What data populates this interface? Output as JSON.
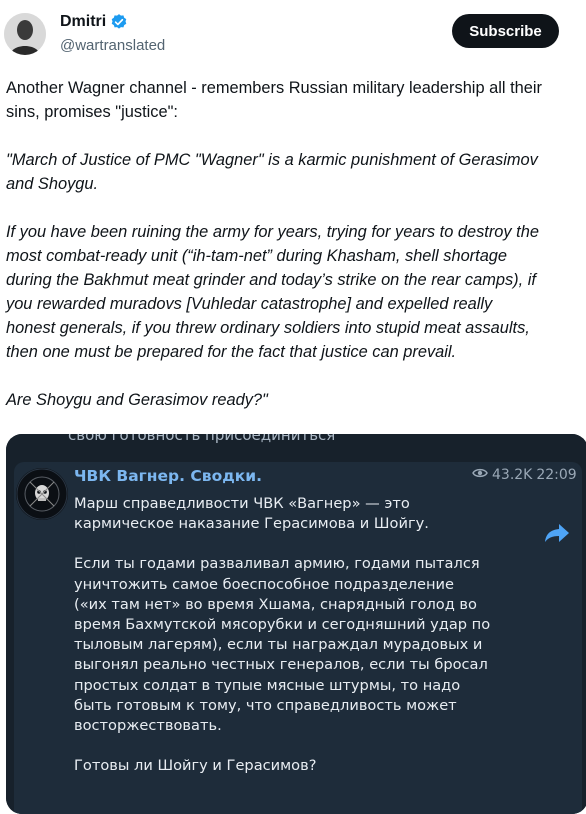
{
  "author": {
    "name": "Dmitri",
    "handle": "@wartranslated",
    "verified_color": "#1d9bf0"
  },
  "subscribe_label": "Subscribe",
  "tweet": {
    "intro": [
      "Another Wagner channel - remembers Russian military leadership all their",
      "sins, promises \"justice\":"
    ],
    "quote_p1": [
      "\"March of Justice of PMC \"Wagner\" is a karmic punishment of Gerasimov",
      "and Shoygu."
    ],
    "quote_p2": [
      "If you have been ruining the army for years, trying for years to destroy the",
      "most combat-ready unit (“ih-tam-net” during Khasham, shell shortage",
      "during the Bakhmut meat grinder and today’s strike on the rear camps), if",
      "you rewarded muradovs [Vuhledar catastrophe] and expelled really",
      "honest generals, if you threw ordinary soldiers into stupid meat assaults,",
      "then one must be prepared for the fact that justice can prevail."
    ],
    "quote_p3": "Are Shoygu and Gerasimov ready?\""
  },
  "telegram": {
    "prev_message_tail": "свою готовность присоединиться",
    "channel_name": "ЧВК Вагнер. Сводки.",
    "views": "43.2K",
    "time": "22:09",
    "p1": [
      "Марш справедливости ЧВК «Вагнер» — это",
      "кармическое наказание Герасимова и Шойгу."
    ],
    "p2": [
      "Если ты годами разваливал армию, годами пытался",
      "уничтожить самое боеспособное подразделение",
      "(«их там нет» во время Хшама, снарядный голод во",
      "время Бахмутской мясорубки и сегодняшний удар по",
      "тыловым лагерям), если ты награждал мурадовых и",
      "выгонял реально честных генералов, если ты бросал",
      "простых солдат в тупые мясные штурмы, то надо",
      "быть готовым к тому, что справедливость может",
      "восторжествовать."
    ],
    "p3": "Готовы ли Шойгу и Герасимов?"
  }
}
